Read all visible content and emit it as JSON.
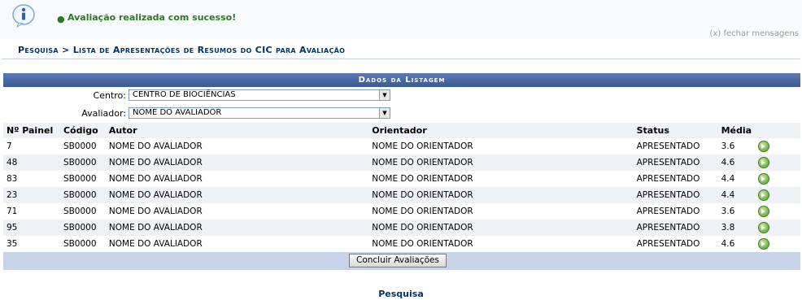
{
  "message": {
    "text": "Avaliação realizada com sucesso!",
    "close": "(x) fechar mensagens"
  },
  "breadcrumb": "Pesquisa > Lista de Apresentações de Resumos do CIC para Avaliação",
  "panel": {
    "title": "Dados da Listagem",
    "centro_label": "Centro:",
    "centro_value": "CENTRO DE BIOCIÊNCIAS",
    "avaliador_label": "Avaliador:",
    "avaliador_value": "NOME DO AVALIADOR"
  },
  "table": {
    "headers": [
      "Nº Painel",
      "Código",
      "Autor",
      "Orientador",
      "Status",
      "Média"
    ],
    "rows": [
      [
        "7",
        "SB0000",
        "NOME DO AVALIADOR",
        "NOME DO ORIENTADOR",
        "APRESENTADO",
        "3.6"
      ],
      [
        "48",
        "SB0000",
        "NOME DO AVALIADOR",
        "NOME DO ORIENTADOR",
        "APRESENTADO",
        "4.6"
      ],
      [
        "83",
        "SB0000",
        "NOME DO AVALIADOR",
        "NOME DO ORIENTADOR",
        "APRESENTADO",
        "4.4"
      ],
      [
        "23",
        "SB0000",
        "NOME DO AVALIADOR",
        "NOME DO ORIENTADOR",
        "APRESENTADO",
        "4.4"
      ],
      [
        "71",
        "SB0000",
        "NOME DO AVALIADOR",
        "NOME DO ORIENTADOR",
        "APRESENTADO",
        "3.6"
      ],
      [
        "95",
        "SB0000",
        "NOME DO AVALIADOR",
        "NOME DO ORIENTADOR",
        "APRESENTADO",
        "3.8"
      ],
      [
        "35",
        "SB0000",
        "NOME DO AVALIADOR",
        "NOME DO ORIENTADOR",
        "APRESENTADO",
        "4.6"
      ]
    ],
    "row_action_icon": "green-arrow-icon"
  },
  "submit_label": "Concluir Avaliações",
  "bottom_link": "Pesquisa",
  "colors": {
    "header_bar": "#3a5a96",
    "success_text": "#2a7a1e",
    "link": "#003366",
    "footer_bar": "#c7d3e8"
  }
}
